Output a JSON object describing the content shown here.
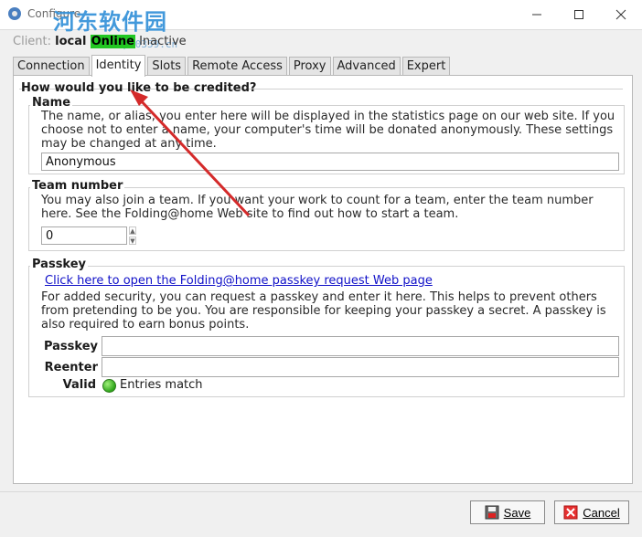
{
  "window": {
    "title": "Configure",
    "watermark": "河东软件园",
    "watermark_url": "www.pc0359.cn"
  },
  "client": {
    "label": "Client:",
    "name": "local",
    "status_online": "Online",
    "status_inactive": "Inactive"
  },
  "tabs": [
    {
      "label": "Connection"
    },
    {
      "label": "Identity",
      "active": true
    },
    {
      "label": "Slots"
    },
    {
      "label": "Remote Access"
    },
    {
      "label": "Proxy"
    },
    {
      "label": "Advanced"
    },
    {
      "label": "Expert"
    }
  ],
  "identity": {
    "heading": "How would you like to be credited?",
    "name_section": {
      "title": "Name",
      "description": "The name, or alias, you enter here will be displayed in the statistics page on our web site.  If you choose not to enter a name, your computer's time will be donated anonymously.  These settings may be changed at any time.",
      "value": "Anonymous"
    },
    "team_section": {
      "title": "Team number",
      "description": "You may also join a team.  If you want your work to count for a team, enter the team number here.  See the Folding@home Web site to find out how to start a team.",
      "value": "0"
    },
    "passkey_section": {
      "title": "Passkey",
      "link": "Click here to open the Folding@home passkey request Web page",
      "description": "For added security, you can request a passkey and enter it here.  This helps to prevent others from pretending to be you.  You are responsible for keeping your passkey a secret.  A passkey is also required to earn bonus points.",
      "passkey_label": "Passkey",
      "passkey_value": "",
      "reenter_label": "Reenter",
      "reenter_value": "",
      "valid_label": "Valid",
      "valid_status": "Entries match"
    }
  },
  "buttons": {
    "save": "Save",
    "cancel": "Cancel"
  },
  "colors": {
    "online": "#22c722",
    "link": "#1010c8",
    "annotation_arrow": "#d42a2a"
  }
}
